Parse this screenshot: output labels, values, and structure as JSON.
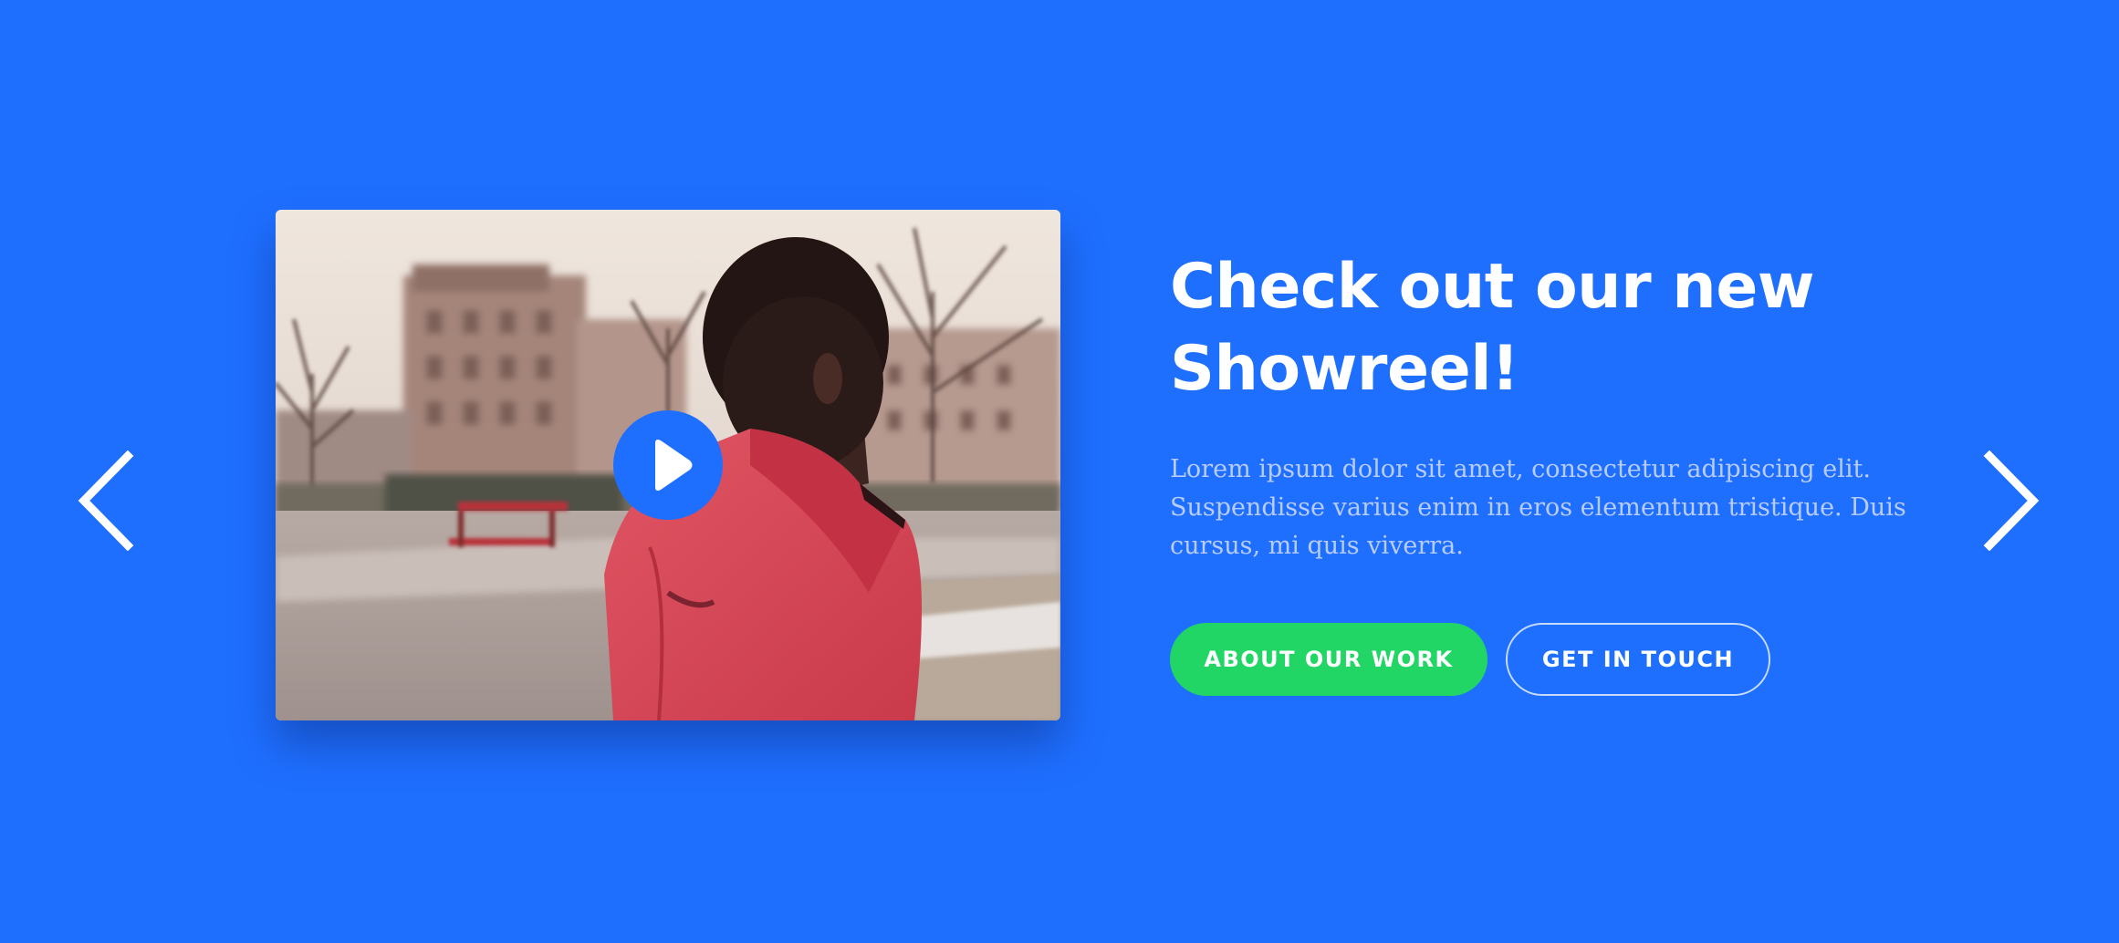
{
  "hero": {
    "title": "Check out our new Showreel!",
    "description": "Lorem ipsum dolor sit amet, consectetur adipiscing elit. Suspendisse varius enim in eros elementum tristique. Duis cursus, mi quis viverra.",
    "primary_button_label": "ABOUT OUR WORK",
    "secondary_button_label": "GET IN TOUCH"
  },
  "slider": {
    "prev_icon": "chevron-left-icon",
    "next_icon": "chevron-right-icon"
  },
  "video": {
    "play_icon": "play-icon"
  },
  "colors": {
    "background": "#1f6fff",
    "primary_button": "#22d666",
    "text": "#ffffff",
    "muted_text": "#b8ccff"
  }
}
